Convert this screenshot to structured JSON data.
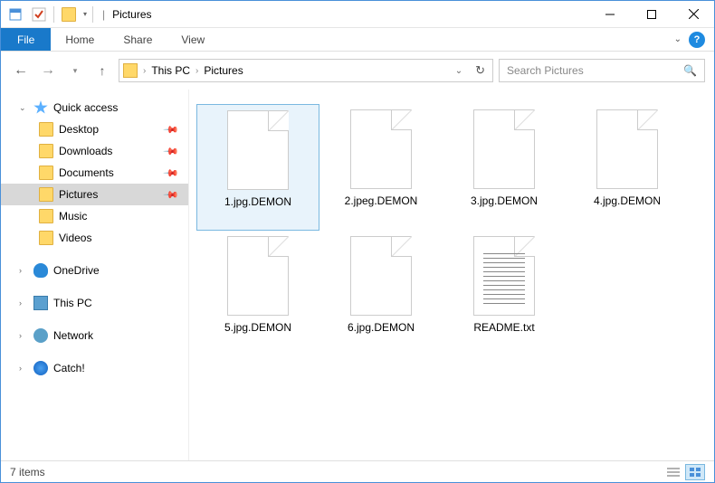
{
  "window": {
    "title": "Pictures",
    "title_sep": "|"
  },
  "ribbon": {
    "file": "File",
    "tabs": [
      "Home",
      "Share",
      "View"
    ]
  },
  "address": {
    "segments": [
      "This PC",
      "Pictures"
    ]
  },
  "search": {
    "placeholder": "Search Pictures"
  },
  "sidebar": {
    "quick_access": "Quick access",
    "quick_items": [
      {
        "label": "Desktop",
        "pinned": true
      },
      {
        "label": "Downloads",
        "pinned": true
      },
      {
        "label": "Documents",
        "pinned": true
      },
      {
        "label": "Pictures",
        "pinned": true,
        "selected": true
      },
      {
        "label": "Music",
        "pinned": false
      },
      {
        "label": "Videos",
        "pinned": false
      }
    ],
    "onedrive": "OneDrive",
    "this_pc": "This PC",
    "network": "Network",
    "catch": "Catch!"
  },
  "files": [
    {
      "name": "1.jpg.DEMON",
      "type": "file",
      "selected": true
    },
    {
      "name": "2.jpeg.DEMON",
      "type": "file"
    },
    {
      "name": "3.jpg.DEMON",
      "type": "file"
    },
    {
      "name": "4.jpg.DEMON",
      "type": "file"
    },
    {
      "name": "5.jpg.DEMON",
      "type": "file"
    },
    {
      "name": "6.jpg.DEMON",
      "type": "file"
    },
    {
      "name": "README.txt",
      "type": "txt"
    }
  ],
  "status": {
    "count": "7 items"
  }
}
